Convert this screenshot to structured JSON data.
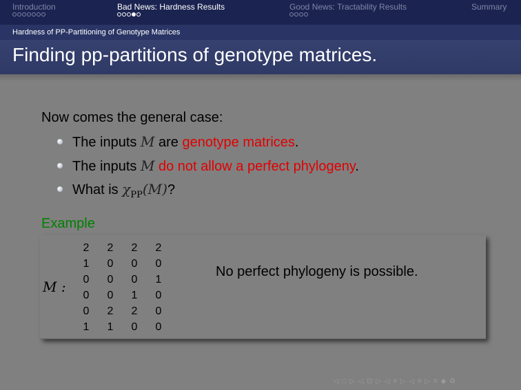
{
  "nav": {
    "sections": [
      {
        "label": "Introduction",
        "dots": 7,
        "filled": -1,
        "active": false
      },
      {
        "label": "Bad News: Hardness Results",
        "dots": 5,
        "filled": 3,
        "active": true
      },
      {
        "label": "Good News: Tractability Results",
        "dots": 4,
        "filled": -1,
        "active": false
      },
      {
        "label": "Summary",
        "dots": 0,
        "filled": -1,
        "active": false
      }
    ]
  },
  "subsection": "Hardness of PP-Partitioning of Genotype Matrices",
  "frame_title": "Finding pp-partitions of genotype matrices.",
  "intro": "Now comes the general case:",
  "bullets": [
    {
      "pre": "The inputs ",
      "math": "M",
      "mid": " are ",
      "red": "genotype matrices",
      "post": "."
    },
    {
      "pre": "The inputs ",
      "math": "M",
      "mid": " ",
      "red": "do not allow a perfect phylogeny",
      "post": "."
    },
    {
      "pre": "What is ",
      "math": "χ",
      "sub": "PP",
      "math2": "(M)",
      "post": "?"
    }
  ],
  "example": {
    "label": "Example",
    "matrix_label": "M :",
    "matrix": [
      [
        "2",
        "2",
        "2",
        "2"
      ],
      [
        "1",
        "0",
        "0",
        "0"
      ],
      [
        "0",
        "0",
        "0",
        "1"
      ],
      [
        "0",
        "0",
        "1",
        "0"
      ],
      [
        "0",
        "2",
        "2",
        "0"
      ],
      [
        "1",
        "1",
        "0",
        "0"
      ]
    ],
    "note": "No perfect phylogeny is possible."
  },
  "footer_nav": "◁ □ ▷ ◁ ⊡ ▷ ◁ ≡ ▷ ◁ ≡ ▷ ≡ ◆ ♻",
  "colors": {
    "highlight": "#e00000",
    "example": "#008000",
    "navbar": "#1b2450"
  }
}
